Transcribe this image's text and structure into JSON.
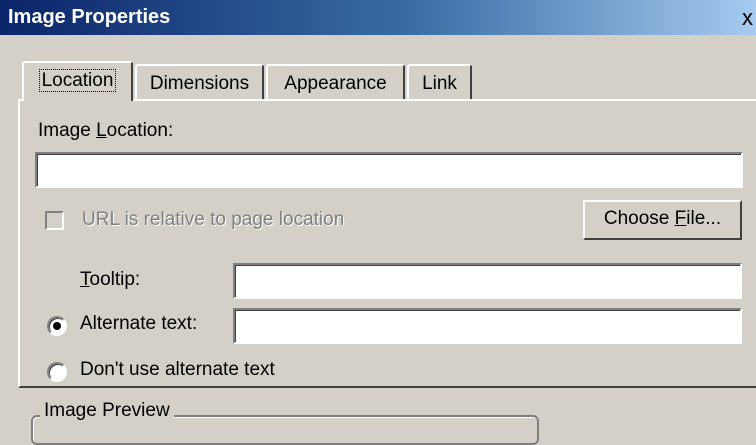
{
  "window": {
    "title": "Image Properties",
    "close_glyph": "x"
  },
  "tabs": [
    {
      "label": "Location",
      "active": true
    },
    {
      "label": "Dimensions",
      "active": false
    },
    {
      "label": "Appearance",
      "active": false
    },
    {
      "label": "Link",
      "active": false
    }
  ],
  "location": {
    "image_location_label_pre": "Image ",
    "image_location_label_key": "L",
    "image_location_label_post": "ocation:",
    "image_location_value": "",
    "relative_url_label": "URL is relative to page location",
    "relative_url_checked": false,
    "choose_file_pre": "Choose ",
    "choose_file_key": "F",
    "choose_file_post": "ile...",
    "tooltip_label_key": "T",
    "tooltip_label_post": "ooltip:",
    "tooltip_value": "",
    "alt_text_label": "Alternate text:",
    "alt_text_value": "",
    "alt_text_selected": true,
    "no_alt_text_label": "Don't use alternate text",
    "no_alt_text_selected": false
  },
  "preview": {
    "group_label": "Image Preview"
  }
}
